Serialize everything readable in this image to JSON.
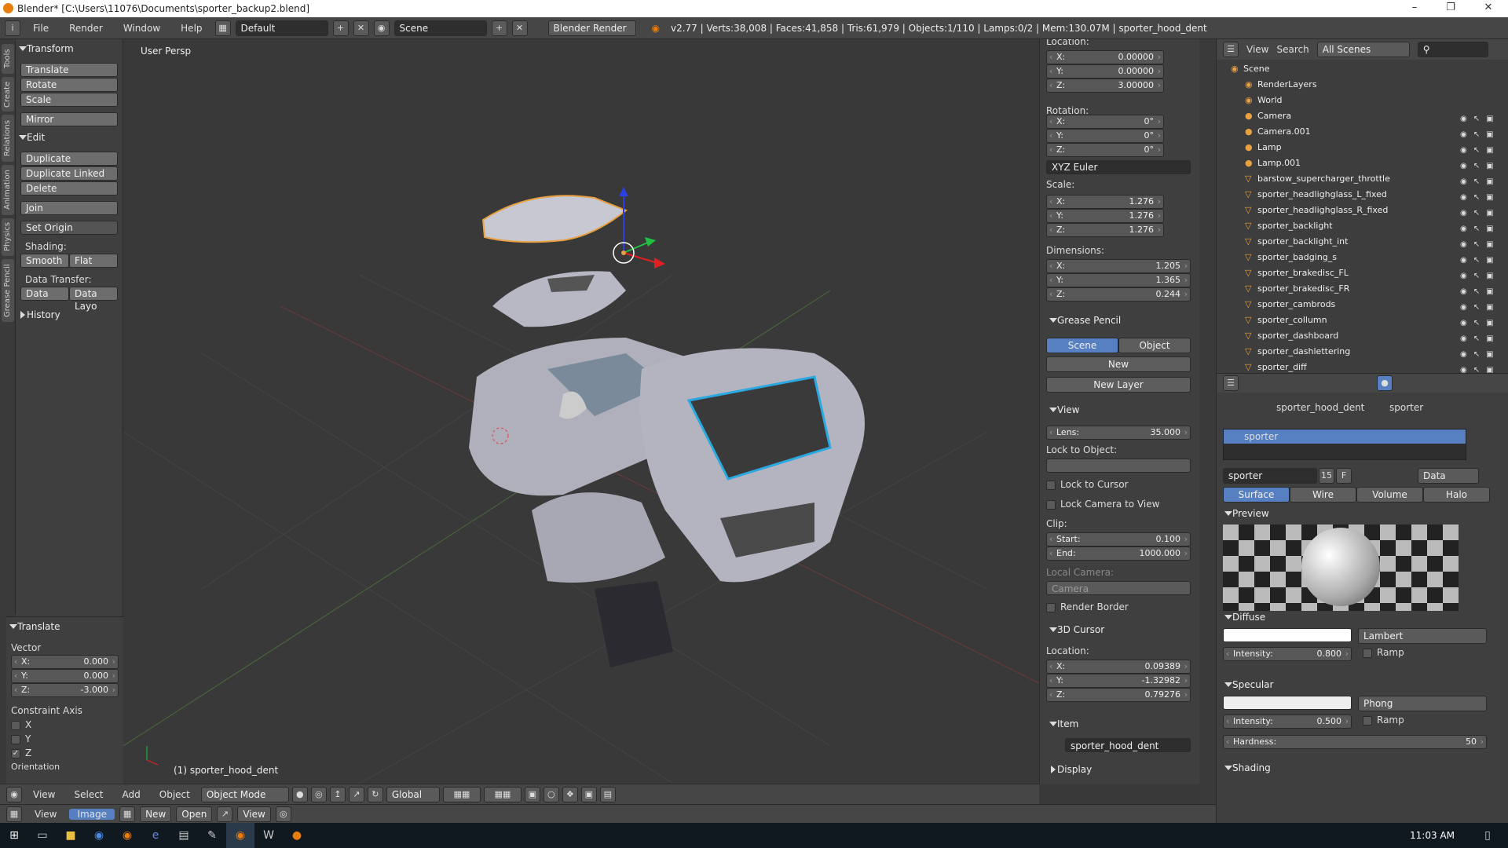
{
  "window": {
    "title": "Blender* [C:\\Users\\11076\\Documents\\sporter_backup2.blend]"
  },
  "menu": [
    "File",
    "Render",
    "Window",
    "Help"
  ],
  "layout": "Default",
  "scene": "Scene",
  "engine": "Blender Render",
  "stats": "v2.77 | Verts:38,008 | Faces:41,858 | Tris:61,979 | Objects:1/110 | Lamps:0/2 | Mem:130.07M | sporter_hood_dent",
  "vtabs": [
    "Tools",
    "Create",
    "Relations",
    "Animation",
    "Physics",
    "Grease Pencil"
  ],
  "tools": {
    "transform": "Transform",
    "translate": "Translate",
    "rotate": "Rotate",
    "scale": "Scale",
    "mirror": "Mirror",
    "edit": "Edit",
    "duplicate": "Duplicate",
    "duplicate_linked": "Duplicate Linked",
    "delete": "Delete",
    "join": "Join",
    "set_origin": "Set Origin",
    "shading": "Shading:",
    "smooth": "Smooth",
    "flat": "Flat",
    "data_transfer": "Data Transfer:",
    "data": "Data",
    "data_layo": "Data Layo",
    "history": "History"
  },
  "operator": {
    "title": "Translate",
    "vector": "Vector",
    "x": "0.000",
    "y": "0.000",
    "z": "-3.000",
    "constraint": "Constraint Axis",
    "cx": "X",
    "cy": "Y",
    "cz": "Z",
    "orientation": "Orientation"
  },
  "viewport": {
    "label": "User Persp",
    "object": "(1) sporter_hood_dent"
  },
  "vpheader": {
    "view": "View",
    "select": "Select",
    "add": "Add",
    "object": "Object",
    "mode": "Object Mode",
    "orientation": "Global"
  },
  "npanel": {
    "location": "Location:",
    "lx": "0.00000",
    "ly": "0.00000",
    "lz": "3.00000",
    "rotation": "Rotation:",
    "rx": "0°",
    "ry": "0°",
    "rz": "0°",
    "euler": "XYZ Euler",
    "scale": "Scale:",
    "sx": "1.276",
    "sy": "1.276",
    "sz": "1.276",
    "dimensions": "Dimensions:",
    "dx": "1.205",
    "dy": "1.365",
    "dz": "0.244",
    "grease": "Grease Pencil",
    "scene_tab": "Scene",
    "object_tab": "Object",
    "new": "New",
    "new_layer": "New Layer",
    "view": "View",
    "lens": "Lens:",
    "lens_val": "35.000",
    "lock_obj": "Lock to Object:",
    "lock_cursor": "Lock to Cursor",
    "lock_camera": "Lock Camera to View",
    "clip": "Clip:",
    "start": "Start:",
    "start_val": "0.100",
    "end": "End:",
    "end_val": "1000.000",
    "local_camera": "Local Camera:",
    "camera": "Camera",
    "render_border": "Render Border",
    "cursor": "3D Cursor",
    "cloc": "Location:",
    "cx": "0.09389",
    "cy": "-1.32982",
    "cz": "0.79276",
    "item": "Item",
    "item_name": "sporter_hood_dent",
    "display": "Display"
  },
  "outliner": {
    "view": "View",
    "search": "Search",
    "filter": "All Scenes",
    "items": [
      "Scene",
      "RenderLayers",
      "World",
      "Camera",
      "Camera.001",
      "Lamp",
      "Lamp.001",
      "barstow_supercharger_throttle",
      "sporter_headlighglass_L_fixed",
      "sporter_headlighglass_R_fixed",
      "sporter_backlight",
      "sporter_backlight_int",
      "sporter_badging_s",
      "sporter_brakedisc_FL",
      "sporter_brakedisc_FR",
      "sporter_cambrods",
      "sporter_collumn",
      "sporter_dashboard",
      "sporter_dashlettering",
      "sporter_diff"
    ]
  },
  "props": {
    "obj": "sporter_hood_dent",
    "mat": "sporter",
    "slot": "sporter",
    "matname": "sporter",
    "users": "15",
    "f": "F",
    "data": "Data",
    "tabs": [
      "Surface",
      "Wire",
      "Volume",
      "Halo"
    ],
    "preview": "Preview",
    "diffuse": "Diffuse",
    "lambert": "Lambert",
    "d_int": "Intensity:",
    "d_int_val": "0.800",
    "ramp": "Ramp",
    "specular": "Specular",
    "phong": "Phong",
    "s_int": "Intensity:",
    "s_int_val": "0.500",
    "hardness": "Hardness:",
    "hard_val": "50",
    "shading": "Shading"
  },
  "bottom": {
    "view": "View",
    "image": "Image",
    "new": "New",
    "open": "Open",
    "view2": "View"
  },
  "taskbar": {
    "time": "11:03 AM"
  }
}
